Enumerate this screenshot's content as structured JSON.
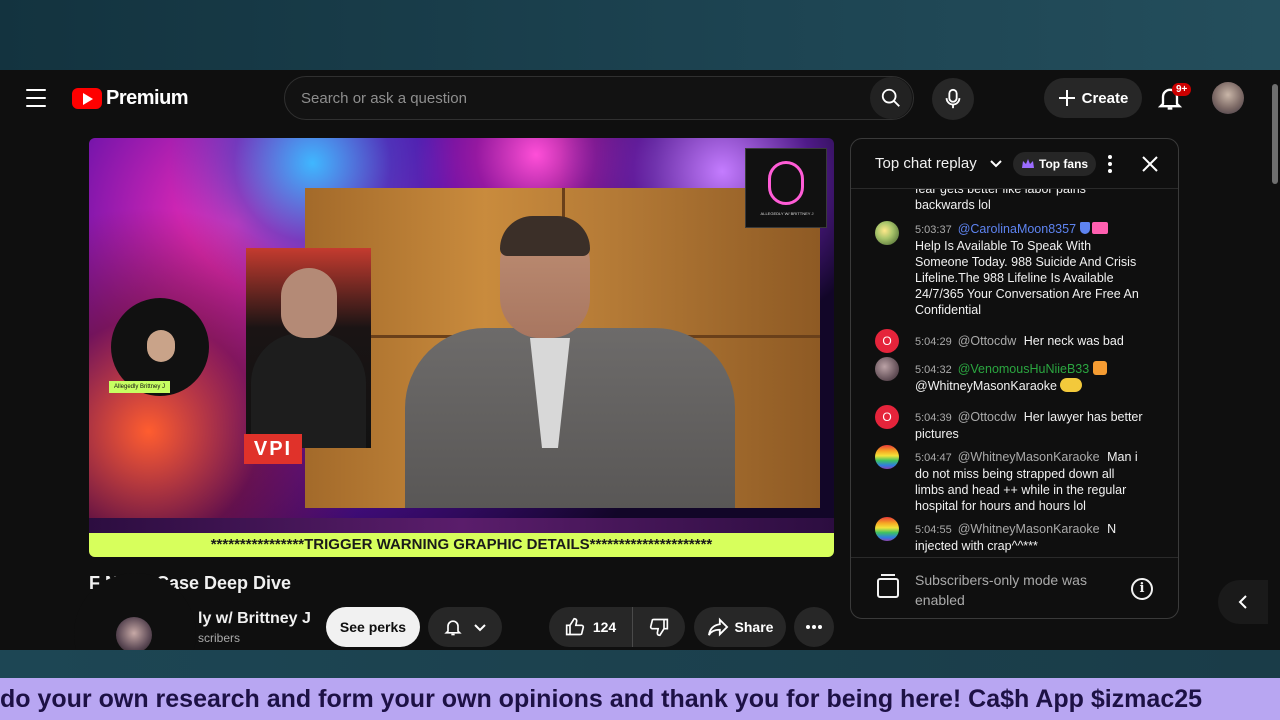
{
  "header": {
    "logo_text": "Premium",
    "search_placeholder": "Search or ask a question",
    "create_label": "Create",
    "notification_count": "9+"
  },
  "video": {
    "trigger_banner": "****************TRIGGER WARNING GRAPHIC DETAILS*********************",
    "left_guest_tag": "VPI",
    "circle_label": "Allegedly Brittney J",
    "mic_logo_text": "ALLEGEDLY W/ BRITTNEY J"
  },
  "title_bar": {
    "title": "F        Night Case Deep Dive",
    "channel_name": "ly w/ Brittney J",
    "subscribers": "scribers",
    "overlay_tag": "izmac25"
  },
  "actions": {
    "perks_label": "See perks",
    "like_count": "124",
    "share_label": "Share"
  },
  "chat": {
    "title": "Top chat replay",
    "top_fans_label": "Top fans",
    "footer_text": "Subscribers-only mode was enabled",
    "messages": [
      {
        "time": "",
        "author": "",
        "text": "fear gets better like labor pains backwards lol"
      },
      {
        "time": "5:03:37",
        "author": "@CarolinaMoon8357",
        "text": "Help Is Available To Speak With Someone Today. 988 Suicide And Crisis Lifeline.The 988 Lifeline Is Available 24/7/365 Your Conversation Are Free An Confidential"
      },
      {
        "time": "5:04:29",
        "author": "@Ottocdw",
        "text": "Her neck was bad",
        "initial": "O"
      },
      {
        "time": "5:04:32",
        "author": "@VenomousHuNiieB33",
        "text": "@WhitneyMasonKaraoke"
      },
      {
        "time": "5:04:39",
        "author": "@Ottocdw",
        "text": "Her lawyer has better pictures",
        "initial": "O"
      },
      {
        "time": "5:04:47",
        "author": "@WhitneyMasonKaraoke",
        "text": "Man i do not miss being strapped down all limbs and head ++ while in the regular hospital for hours and hours lol"
      },
      {
        "time": "5:04:55",
        "author": "@WhitneyMasonKaraoke",
        "text": "N injected with crap^^***"
      }
    ]
  },
  "ticker": {
    "text": "do your own research and form your own opinions and thank you for being here! Ca$h App $izmac25"
  }
}
